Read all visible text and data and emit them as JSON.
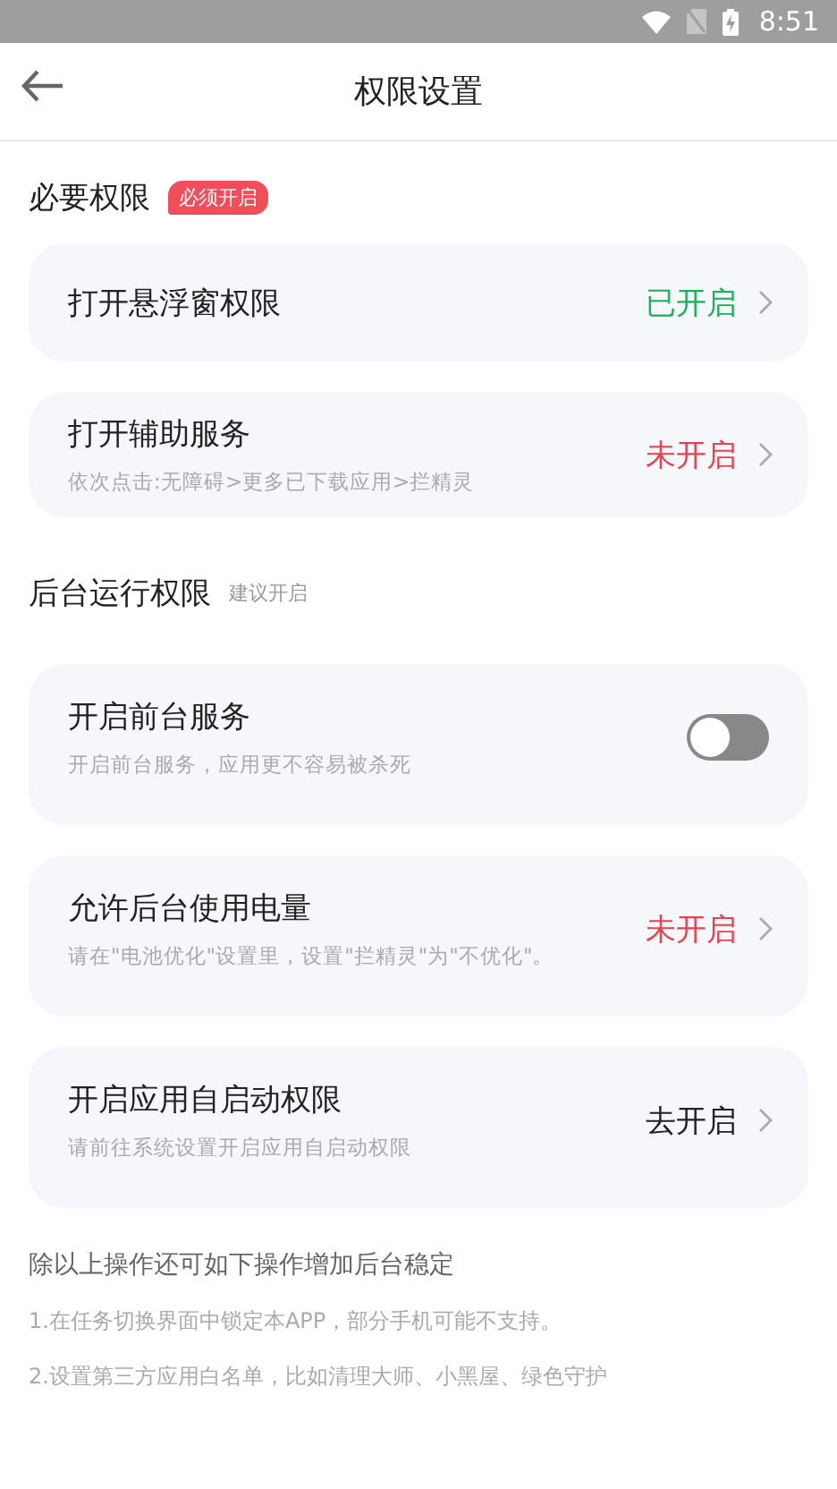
{
  "status_bar": {
    "time": "8:51"
  },
  "header": {
    "title": "权限设置"
  },
  "sections": [
    {
      "title": "必要权限",
      "tag": {
        "text": "必须开启",
        "kind": "badge"
      },
      "items": [
        {
          "kind": "status",
          "title": "打开悬浮窗权限",
          "status": {
            "text": "已开启",
            "kind": "on"
          }
        },
        {
          "kind": "status",
          "title": "打开辅助服务",
          "subtitle": "依次点击:无障碍>更多已下载应用>拦精灵",
          "status": {
            "text": "未开启",
            "kind": "off"
          }
        }
      ]
    },
    {
      "title": "后台运行权限",
      "tag": {
        "text": "建议开启",
        "kind": "hint"
      },
      "items": [
        {
          "kind": "switch",
          "title": "开启前台服务",
          "subtitle": "开启前台服务，应用更不容易被杀死",
          "on": false
        },
        {
          "kind": "status",
          "title": "允许后台使用电量",
          "subtitle": "请在\"电池优化\"设置里，设置\"拦精灵\"为\"不优化\"。",
          "status": {
            "text": "未开启",
            "kind": "off"
          }
        },
        {
          "kind": "status",
          "title": "开启应用自启动权限",
          "subtitle": "请前往系统设置开启应用自启动权限",
          "status": {
            "text": "去开启",
            "kind": "action"
          }
        }
      ]
    }
  ],
  "footer": {
    "title": "除以上操作还可如下操作增加后台稳定",
    "notes": [
      "1.在任务切换界面中锁定本APP，部分手机可能不支持。",
      "2.设置第三方应用白名单，比如清理大师、小黑屋、绿色守护"
    ]
  }
}
